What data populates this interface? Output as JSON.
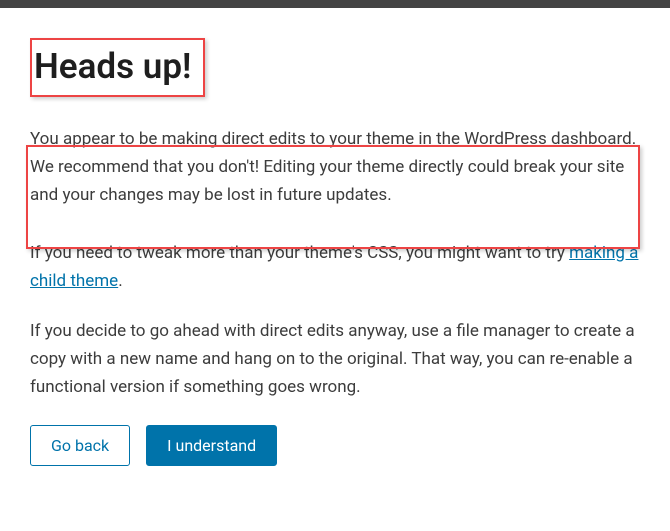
{
  "heading": "Heads up!",
  "paragraph1": "You appear to be making direct edits to your theme in the WordPress dashboard. We recommend that you don't! Editing your theme directly could break your site and your changes may be lost in future updates.",
  "paragraph2_prefix": "If you need to tweak more than your theme's CSS, you might want to try ",
  "paragraph2_link": "making a child theme",
  "paragraph2_suffix": ".",
  "paragraph3": "If you decide to go ahead with direct edits anyway, use a file manager to create a copy with a new name and hang on to the original. That way, you can re-enable a functional version if something goes wrong.",
  "buttons": {
    "go_back": "Go back",
    "understand": "I understand"
  }
}
